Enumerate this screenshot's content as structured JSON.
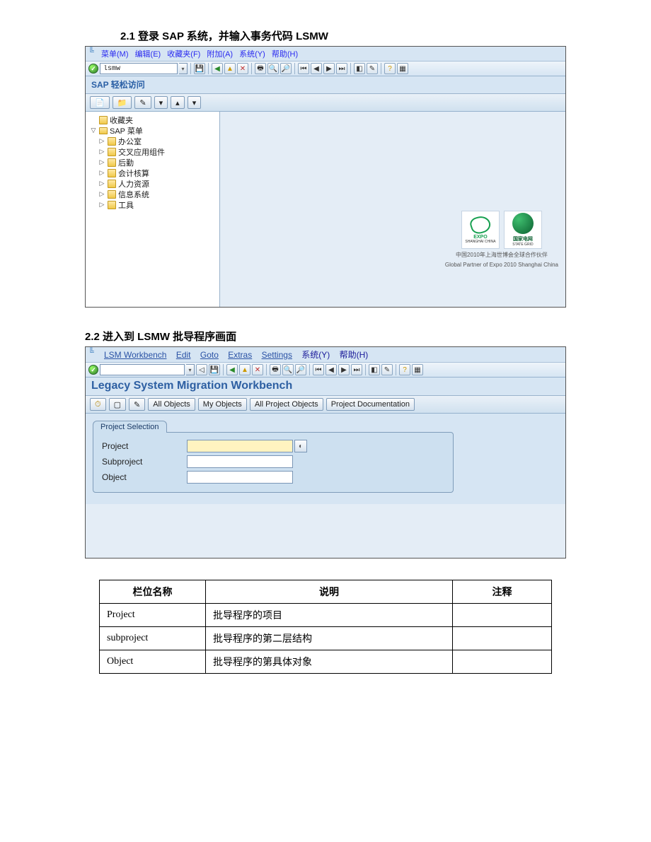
{
  "section1": {
    "heading": "2.1 登录 SAP 系统，并输入事务代码 LSMW",
    "menubar": [
      "菜单(M)",
      "编辑(E)",
      "收藏夹(F)",
      "附加(A)",
      "系统(Y)",
      "帮助(H)"
    ],
    "tcode_value": "lsmw",
    "title": "SAP 轻松访问",
    "tree": {
      "root1": "收藏夹",
      "root2": "SAP 菜单",
      "children": [
        "办公室",
        "交叉应用组件",
        "后勤",
        "会计核算",
        "人力资源",
        "信息系统",
        "工具"
      ]
    },
    "branding": {
      "logo1_line1": "EXPO",
      "logo1_line2": "SHANGHAI CHINA",
      "logo2_line1": "国家电网",
      "logo2_line2": "STATE GRID",
      "footer1": "中国2010年上海世博会全球合作伙伴",
      "footer2": "Global Partner of Expo 2010 Shanghai China"
    }
  },
  "section2": {
    "heading": "2.2  进入到 LSMW 批导程序画面",
    "menubar_en": [
      "LSM Workbench",
      "Edit",
      "Goto",
      "Extras",
      "Settings"
    ],
    "menubar_cn": [
      "系统(Y)",
      "帮助(H)"
    ],
    "title": "Legacy System Migration Workbench",
    "buttons": {
      "all_objects": "All Objects",
      "my_objects": "My Objects",
      "all_project_objects": "All Project Objects",
      "project_documentation": "Project Documentation"
    },
    "panel": {
      "tab": "Project Selection",
      "fields": {
        "project_label": "Project",
        "subproject_label": "Subproject",
        "object_label": "Object",
        "project_value": "",
        "subproject_value": "",
        "object_value": ""
      }
    }
  },
  "table": {
    "headers": [
      "栏位名称",
      "说明",
      "注释"
    ],
    "rows": [
      {
        "c1": "Project",
        "c2": "批导程序的项目",
        "c3": ""
      },
      {
        "c1": "subproject",
        "c2": "批导程序的第二层结构",
        "c3": ""
      },
      {
        "c1": "Object",
        "c2": "批导程序的第具体对象",
        "c3": ""
      }
    ]
  }
}
